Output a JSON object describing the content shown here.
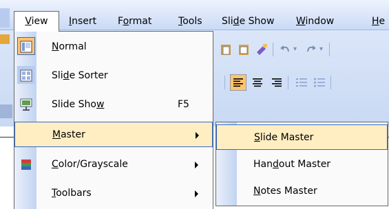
{
  "menubar": {
    "items": [
      {
        "label": "View",
        "underline": "V"
      },
      {
        "label": "Insert",
        "underline": "I"
      },
      {
        "label": "Format",
        "underline": "o"
      },
      {
        "label": "Tools",
        "underline": "T"
      },
      {
        "label": "Slide Show",
        "underline": "d"
      },
      {
        "label": "Window",
        "underline": "W"
      },
      {
        "label": "He",
        "underline": "H"
      }
    ]
  },
  "view_menu": {
    "items": [
      {
        "label": "Normal",
        "icon": "normal-view-icon",
        "state": "checked"
      },
      {
        "label": "Slide Sorter",
        "icon": "slide-sorter-icon"
      },
      {
        "label": "Slide Show",
        "icon": "slide-show-icon",
        "shortcut": "F5"
      },
      {
        "label": "Master",
        "submenu": true,
        "state": "highlighted"
      },
      {
        "label": "Color/Grayscale",
        "icon": "color-grayscale-icon",
        "submenu": true
      },
      {
        "label": "Toolbars",
        "submenu": true
      }
    ]
  },
  "master_submenu": {
    "items": [
      {
        "label": "Slide Master",
        "state": "highlighted"
      },
      {
        "label": "Handout Master"
      },
      {
        "label": "Notes Master"
      }
    ]
  },
  "colors": {
    "highlight": "#ffeec2",
    "highlight_border": "#316ac5",
    "checked_bg": "#ffc56e",
    "menubar_top": "#eef3fd",
    "menubar_bottom": "#c9daf6"
  }
}
